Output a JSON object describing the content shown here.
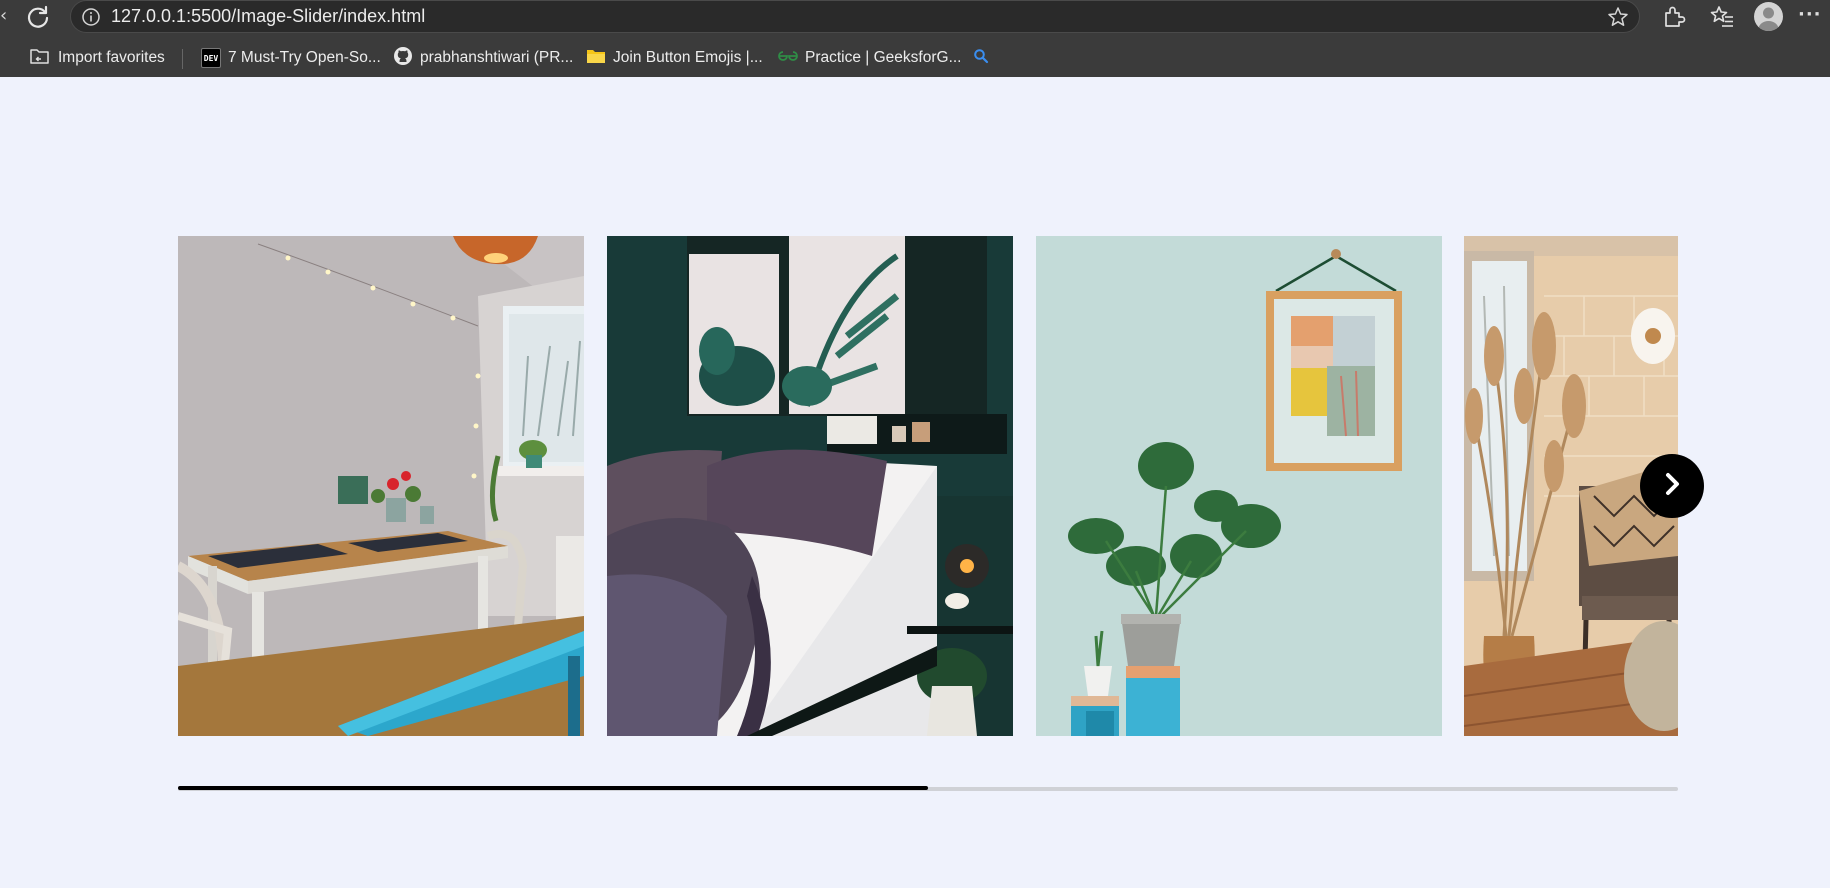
{
  "browser": {
    "url": "127.0.0.1:5500/Image-Slider/index.html",
    "bookmarks": [
      {
        "label": "Import favorites",
        "icon": "import-favorites-icon"
      },
      {
        "label": "7 Must-Try Open-So...",
        "icon": "dev-to-icon",
        "badge": "DEV"
      },
      {
        "label": "prabhanshtiwari (PR...",
        "icon": "github-icon"
      },
      {
        "label": "Join Button Emojis |...",
        "icon": "folder-icon"
      },
      {
        "label": "Practice | GeeksforG...",
        "icon": "geeksforgeeks-icon"
      },
      {
        "label": "",
        "icon": "search-icon"
      }
    ]
  },
  "slider": {
    "slides": [
      {
        "subject": "dining nook with wooden table, blue bench and string lights"
      },
      {
        "subject": "bedroom with purple linen bedding and botanical prints"
      },
      {
        "subject": "mint wall with framed abstract art and monstera plant"
      },
      {
        "subject": "warm brick interior with pampas grass and armchair"
      }
    ],
    "next_icon": "chevron-right-icon",
    "scroll_progress": 0.5
  },
  "colors": {
    "page_background": "#eff2fc",
    "chrome_background": "#3b3b3b",
    "scrollbar_thumb": "#000000",
    "scrollbar_track": "#cfd1d6"
  }
}
